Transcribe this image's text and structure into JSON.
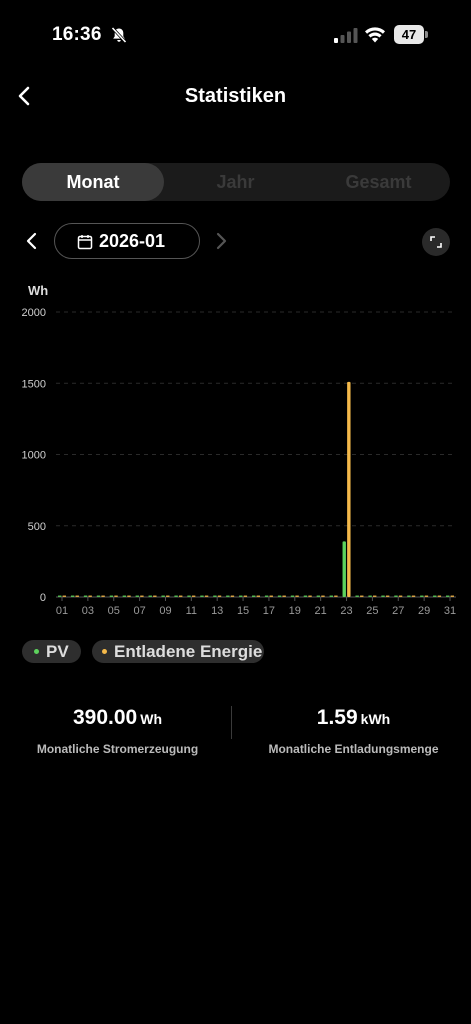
{
  "status_bar": {
    "time": "16:36",
    "battery_level": "47"
  },
  "header": {
    "title": "Statistiken"
  },
  "tabs": [
    {
      "label": "Monat",
      "active": true
    },
    {
      "label": "Jahr",
      "active": false
    },
    {
      "label": "Gesamt",
      "active": false
    }
  ],
  "date_selector": {
    "value": "2026-01"
  },
  "chart": {
    "unit": "Wh"
  },
  "chart_data": {
    "type": "bar",
    "ylim": [
      0,
      2000
    ],
    "y_ticks": [
      0,
      500,
      1000,
      1500,
      2000
    ],
    "x_tick_labels": [
      "01",
      "03",
      "05",
      "07",
      "09",
      "11",
      "13",
      "15",
      "17",
      "19",
      "21",
      "23",
      "25",
      "27",
      "29",
      "31"
    ],
    "days": [
      1,
      2,
      3,
      4,
      5,
      6,
      7,
      8,
      9,
      10,
      11,
      12,
      13,
      14,
      15,
      16,
      17,
      18,
      19,
      20,
      21,
      22,
      23,
      24,
      25,
      26,
      27,
      28,
      29,
      30,
      31
    ],
    "series": [
      {
        "name": "PV",
        "color": "#5dd35d",
        "values": [
          0,
          0,
          0,
          0,
          0,
          0,
          0,
          0,
          0,
          0,
          0,
          0,
          0,
          0,
          0,
          0,
          0,
          0,
          0,
          0,
          0,
          0,
          390,
          0,
          0,
          0,
          0,
          0,
          0,
          0,
          0
        ]
      },
      {
        "name": "Entladene Energie",
        "color": "#f4b94a",
        "values": [
          0,
          0,
          0,
          0,
          0,
          0,
          0,
          0,
          0,
          0,
          0,
          0,
          0,
          0,
          0,
          0,
          0,
          0,
          0,
          0,
          0,
          0,
          1510,
          0,
          0,
          0,
          0,
          0,
          0,
          0,
          0
        ]
      }
    ],
    "grid": true
  },
  "legend": {
    "pv_label": "PV",
    "pv_color": "#5dd35d",
    "energy_label": "Entladene Energie",
    "energy_color": "#f4b94a"
  },
  "stats": {
    "generation": {
      "value": "390.00",
      "unit": "Wh",
      "caption": "Monatliche Stromerzeugung"
    },
    "discharge": {
      "value": "1.59",
      "unit": "kWh",
      "caption": "Monatliche Entladungsmenge"
    }
  }
}
